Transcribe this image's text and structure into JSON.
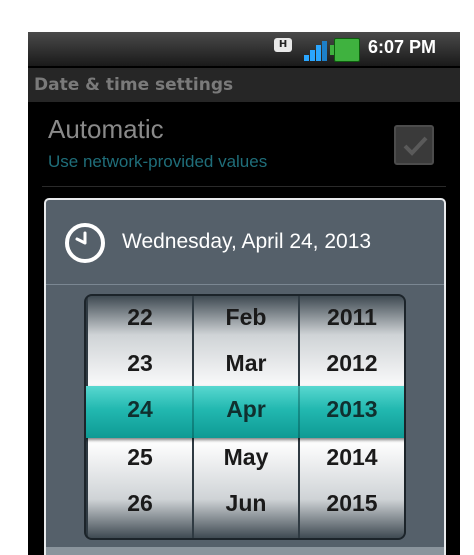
{
  "status_bar": {
    "network_badge": "H",
    "time": "6:07 PM",
    "icons": [
      "hsdpa-icon",
      "signal-icon",
      "battery-icon"
    ]
  },
  "settings": {
    "header": "Date & time settings",
    "automatic": {
      "title": "Automatic",
      "subtitle": "Use network-provided values",
      "checked": true
    }
  },
  "dialog": {
    "title_date": "Wednesday, April 24, 2013",
    "icon": "clock-icon",
    "picker": {
      "days": [
        "22",
        "23",
        "24",
        "25",
        "26"
      ],
      "months": [
        "Feb",
        "Mar",
        "Apr",
        "May",
        "Jun"
      ],
      "years": [
        "2011",
        "2012",
        "2013",
        "2014",
        "2015"
      ],
      "selected_index": 2
    }
  },
  "colors": {
    "selection": "#22b8b0",
    "subtitle": "#1f6e7a",
    "battery": "#3fb23f",
    "signal": "#2aa6ff"
  }
}
